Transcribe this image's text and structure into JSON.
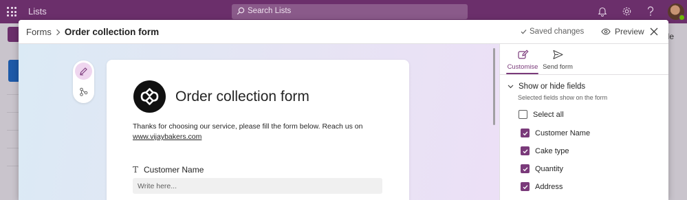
{
  "app": {
    "name": "Lists",
    "search_placeholder": "Search Lists"
  },
  "background": {
    "partial_text": "ole"
  },
  "dialog": {
    "breadcrumb": {
      "parent": "Forms",
      "current": "Order collection form"
    },
    "saved_status": "Saved changes",
    "preview_label": "Preview"
  },
  "form": {
    "title": "Order collection form",
    "description": "Thanks for choosing our service, please fill the form below. Reach us on",
    "link": "www.vijaybakers.com",
    "question": {
      "label": "Customer Name",
      "placeholder": "Write here..."
    }
  },
  "panel": {
    "tabs": [
      {
        "label": "Customise",
        "icon": "edit-icon",
        "active": true
      },
      {
        "label": "Send form",
        "icon": "send-icon",
        "active": false
      }
    ],
    "section_title": "Show or hide fields",
    "section_subtitle": "Selected fields show on the form",
    "select_all_label": "Select all",
    "fields": [
      {
        "label": "Customer Name",
        "checked": true
      },
      {
        "label": "Cake type",
        "checked": true
      },
      {
        "label": "Quantity",
        "checked": true
      },
      {
        "label": "Address",
        "checked": true
      }
    ]
  },
  "colors": {
    "brand": "#6b2f6b",
    "accent": "#7a3a7a"
  }
}
